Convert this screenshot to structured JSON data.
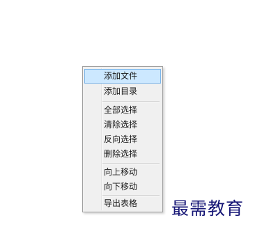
{
  "context_menu": {
    "items": [
      {
        "label": "添加文件",
        "highlighted": true
      },
      {
        "label": "添加目录",
        "highlighted": false
      },
      {
        "label": "全部选择",
        "highlighted": false
      },
      {
        "label": "清除选择",
        "highlighted": false
      },
      {
        "label": "反向选择",
        "highlighted": false
      },
      {
        "label": "删除选择",
        "highlighted": false
      },
      {
        "label": "向上移动",
        "highlighted": false
      },
      {
        "label": "向下移动",
        "highlighted": false
      },
      {
        "label": "导出表格",
        "highlighted": false
      }
    ],
    "highlight_color": "#cce8ff",
    "highlight_border_color": "#7ab4e8"
  },
  "watermark": {
    "text": "最需教育",
    "color": "#151575"
  }
}
